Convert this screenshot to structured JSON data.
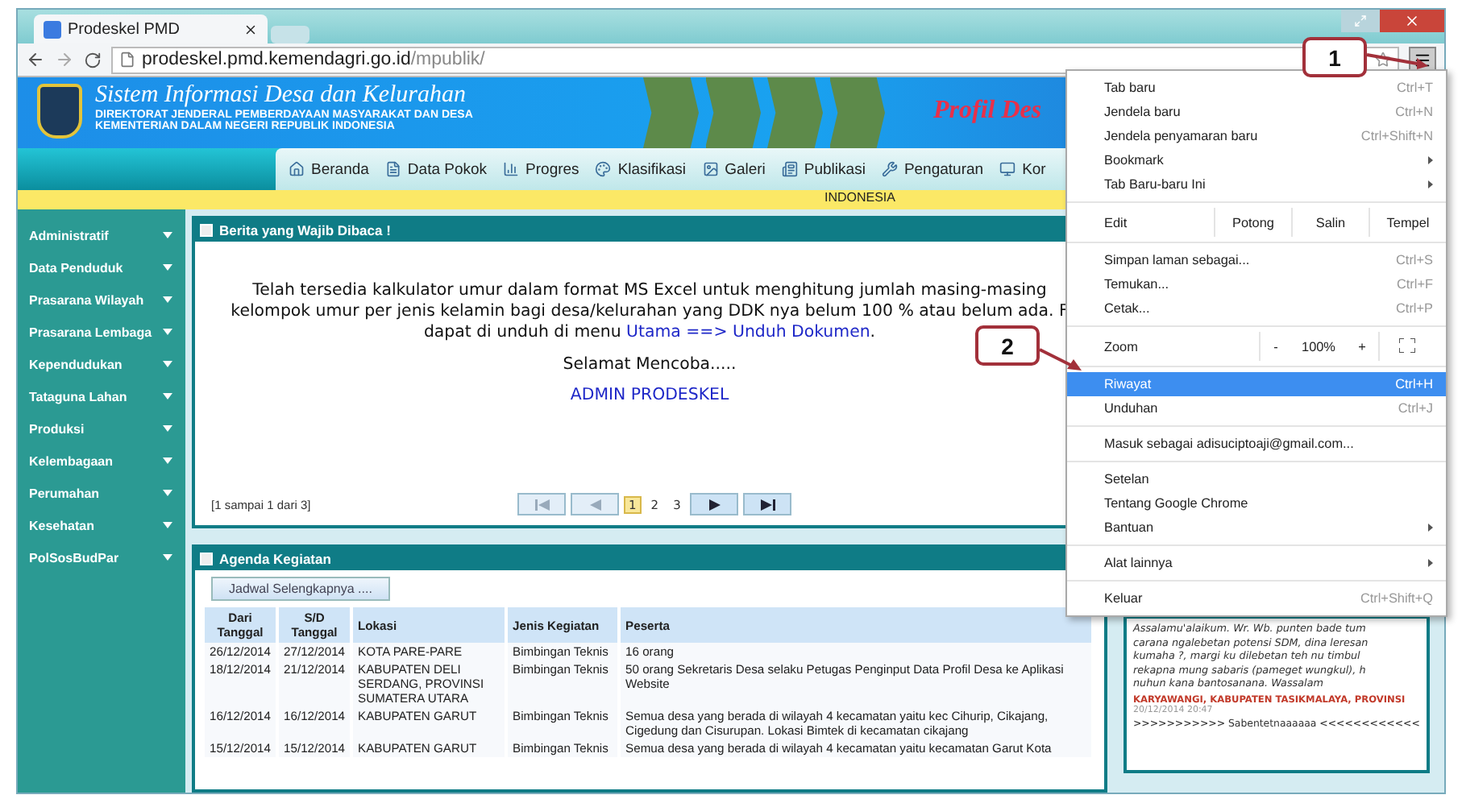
{
  "tab": {
    "title": "Prodeskel PMD"
  },
  "address": {
    "host": "prodeskel.pmd.kemendagri.go.id",
    "path": "/mpublik/"
  },
  "banner": {
    "title": "Sistem Informasi Desa dan Kelurahan",
    "subtitle_1": "DIREKTORAT JENDERAL PEMBERDAYAAN MASYARAKAT DAN DESA",
    "subtitle_2": "KEMENTERIAN DALAM NEGERI REPUBLIK INDONESIA",
    "tagline": "Profil Des"
  },
  "nav": [
    "Beranda",
    "Data Pokok",
    "Progres",
    "Klasifikasi",
    "Galeri",
    "Publikasi",
    "Pengaturan",
    "Kor"
  ],
  "region": "INDONESIA",
  "sidebar": [
    "Administratif",
    "Data Penduduk",
    "Prasarana Wilayah",
    "Prasarana Lembaga",
    "Kependudukan",
    "Tataguna Lahan",
    "Produksi",
    "Kelembagaan",
    "Perumahan",
    "Kesehatan",
    "PolSosBudPar"
  ],
  "news": {
    "title": "Berita yang Wajib Dibaca !",
    "lines": [
      "Telah tersedia kalkulator umur dalam format MS Excel untuk menghitung jumlah masing-masing",
      "kelompok umur per jenis kelamin bagi desa/kelurahan yang DDK nya belum 100 % atau belum ada.  F"
    ],
    "line_3_before": "dapat di unduh di menu ",
    "line_3_link": "Utama ==> Unduh Dokumen",
    "line_3_after": ".",
    "greeting": "Selamat Mencoba.....",
    "signature": "ADMIN PRODESKEL",
    "pager_info": "[1 sampai 1 dari 3]",
    "pages": [
      {
        "label": "1",
        "selected": true
      },
      {
        "label": "2",
        "selected": false
      },
      {
        "label": "3",
        "selected": false
      }
    ]
  },
  "agenda": {
    "title": "Agenda Kegiatan",
    "button": "Jadwal Selengkapnya ....",
    "columns": [
      "Dari Tanggal",
      "S/D Tanggal",
      "Lokasi",
      "Jenis Kegiatan",
      "Peserta"
    ],
    "rows": [
      [
        "26/12/2014",
        "27/12/2014",
        "KOTA PARE-PARE",
        "Bimbingan Teknis",
        "16 orang"
      ],
      [
        "18/12/2014",
        "21/12/2014",
        "KABUPATEN DELI SERDANG, PROVINSI SUMATERA UTARA",
        "Bimbingan Teknis",
        "50 orang Sekretaris Desa selaku Petugas Penginput Data Profil Desa ke Aplikasi Website"
      ],
      [
        "16/12/2014",
        "16/12/2014",
        "KABUPATEN GARUT",
        "Bimbingan Teknis",
        "Semua desa yang berada di wilayah 4 kecamatan yaitu kec Cihurip, Cikajang, Cigedung dan Cisurupan. Lokasi Bimtek di kecamatan cikajang"
      ],
      [
        "15/12/2014",
        "15/12/2014",
        "KABUPATEN GARUT",
        "Bimbingan Teknis",
        "Semua desa yang berada di wilayah 4 kecamatan yaitu kecamatan Garut Kota"
      ]
    ]
  },
  "comment": {
    "lines": [
      "Assalamu'alaikum. Wr. Wb. punten bade tum",
      "carana ngalebetan potensi SDM, dina leresan",
      "kumaha ?, margi ku dilebetan teh nu timbul",
      "rekapna mung sabaris (pameget wungkul), h",
      "nuhun kana bantosanana. Wassalam"
    ],
    "location": "KARYAWANGI, KABUPATEN TASIKMALAYA, PROVINSI",
    "time": "20/12/2014 20:47",
    "next": ">>>>>>>>>>> Sabentetnaaaaaa <<<<<<<<<<<<"
  },
  "menu": [
    {
      "kind": "items",
      "items": [
        {
          "label": "Tab baru",
          "shortcut": "Ctrl+T",
          "submenu": false,
          "selected": false
        },
        {
          "label": "Jendela baru",
          "shortcut": "Ctrl+N",
          "submenu": false,
          "selected": false
        },
        {
          "label": "Jendela penyamaran baru",
          "shortcut": "Ctrl+Shift+N",
          "submenu": false,
          "selected": false
        },
        {
          "label": "Bookmark",
          "submenu": true,
          "selected": false
        },
        {
          "label": "Tab Baru-baru Ini",
          "submenu": true,
          "selected": false
        }
      ]
    },
    {
      "kind": "edit",
      "label": "Edit",
      "buttons": [
        "Potong",
        "Salin",
        "Tempel"
      ]
    },
    {
      "kind": "items",
      "items": [
        {
          "label": "Simpan laman sebagai...",
          "shortcut": "Ctrl+S",
          "submenu": false,
          "selected": false
        },
        {
          "label": "Temukan...",
          "shortcut": "Ctrl+F",
          "submenu": false,
          "selected": false
        },
        {
          "label": "Cetak...",
          "shortcut": "Ctrl+P",
          "submenu": false,
          "selected": false
        }
      ]
    },
    {
      "kind": "zoom",
      "label": "Zoom",
      "minus": "-",
      "value": "100%",
      "plus": "+"
    },
    {
      "kind": "items",
      "items": [
        {
          "label": "Riwayat",
          "shortcut": "Ctrl+H",
          "submenu": false,
          "selected": true
        },
        {
          "label": "Unduhan",
          "shortcut": "Ctrl+J",
          "submenu": false,
          "selected": false
        }
      ]
    },
    {
      "kind": "items",
      "items": [
        {
          "label": "Masuk sebagai adisuciptoaji@gmail.com...",
          "submenu": false,
          "selected": false
        }
      ]
    },
    {
      "kind": "items",
      "items": [
        {
          "label": "Setelan",
          "submenu": false,
          "selected": false
        },
        {
          "label": "Tentang Google Chrome",
          "submenu": false,
          "selected": false
        },
        {
          "label": "Bantuan",
          "submenu": true,
          "selected": false
        }
      ]
    },
    {
      "kind": "items",
      "items": [
        {
          "label": "Alat lainnya",
          "submenu": true,
          "selected": false
        }
      ]
    },
    {
      "kind": "items",
      "items": [
        {
          "label": "Keluar",
          "shortcut": "Ctrl+Shift+Q",
          "submenu": false,
          "selected": false
        }
      ]
    }
  ],
  "callouts": [
    "1",
    "2"
  ]
}
